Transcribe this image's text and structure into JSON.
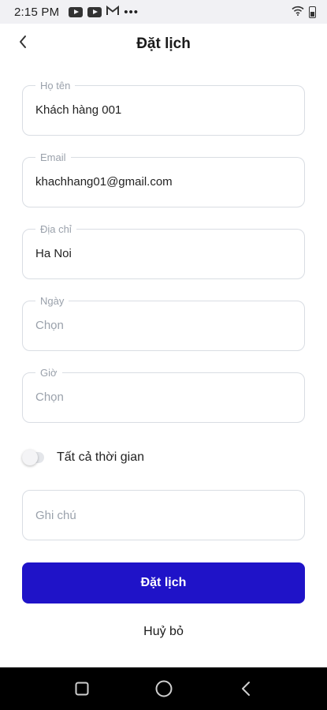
{
  "status_bar": {
    "time": "2:15 PM",
    "notification_icons": [
      "youtube-icon",
      "youtube-icon",
      "gmail-icon",
      "more-dots-icon"
    ],
    "right_icons": [
      "wifi-icon",
      "battery-icon"
    ]
  },
  "header": {
    "title": "Đặt lịch",
    "back_icon": "chevron-left-icon"
  },
  "form": {
    "fields": [
      {
        "label": "Họ tên",
        "value": "Khách hàng 001"
      },
      {
        "label": "Email",
        "value": "khachhang01@gmail.com"
      },
      {
        "label": "Địa chỉ",
        "value": "Ha Noi"
      },
      {
        "label": "Ngày",
        "placeholder": "Chọn"
      },
      {
        "label": "Giờ",
        "placeholder": "Chọn"
      }
    ],
    "all_time_toggle": {
      "label": "Tất cả thời gian",
      "on": false
    },
    "note": {
      "placeholder": "Ghi chú"
    },
    "submit_label": "Đặt lịch",
    "cancel_label": "Huỷ bỏ"
  },
  "nav_bar": {
    "icons": [
      "recent-apps-icon",
      "home-icon",
      "back-icon"
    ]
  },
  "colors": {
    "primary": "#1f13c8",
    "field_border": "#d9dde3",
    "placeholder": "#9aa1ab",
    "status_bar_bg": "#f1f1f4"
  }
}
